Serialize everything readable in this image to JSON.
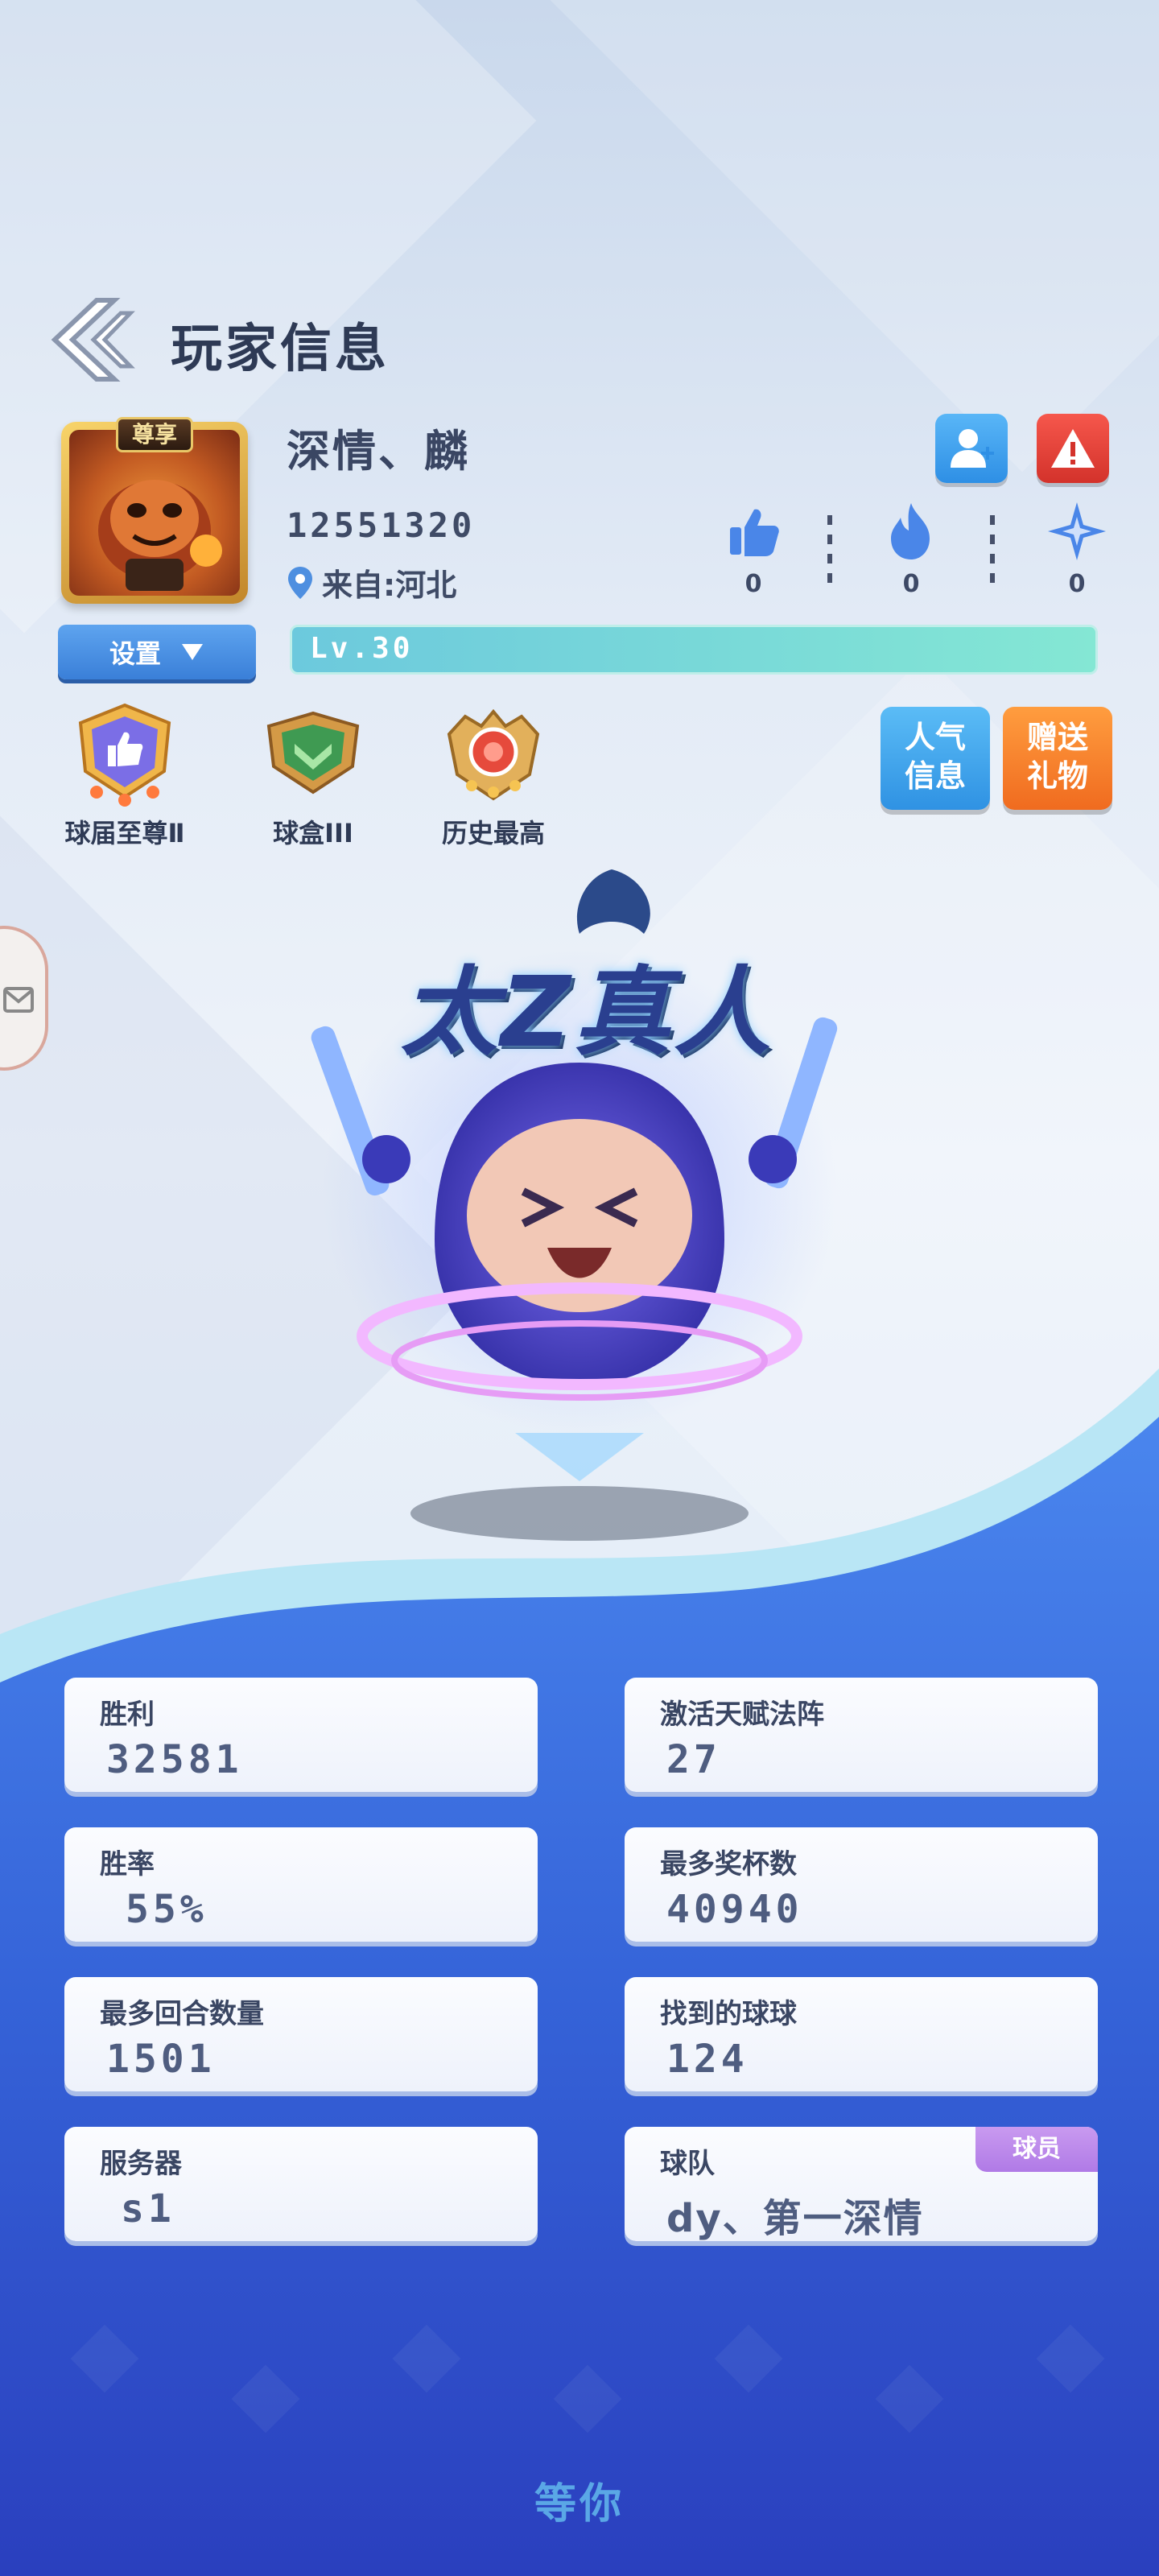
{
  "header": {
    "back_icon": "double-chevron-left-icon",
    "title": "玩家信息"
  },
  "profile": {
    "avatar_badge": "尊享",
    "name": "深情、麟",
    "id": "12551320",
    "location": "来自:河北",
    "settings_label": "设置",
    "level": "Lv.30"
  },
  "actions": {
    "add_friend_icon": "add-user-icon",
    "report_icon": "warning-icon"
  },
  "stats_icons": [
    {
      "name": "like",
      "value": "0"
    },
    {
      "name": "fire",
      "value": "0"
    },
    {
      "name": "star",
      "value": "0"
    }
  ],
  "badges": [
    {
      "label": "球届至尊Ⅱ"
    },
    {
      "label": "球盒III"
    },
    {
      "label": "历史最高"
    }
  ],
  "side_buttons": {
    "popularity_line1": "人气",
    "popularity_line2": "信息",
    "gift_line1": "赠送",
    "gift_line2": "礼物"
  },
  "hero": {
    "title": "太Z真人"
  },
  "stats": {
    "wins_label": "胜利",
    "wins_value": "32581",
    "talent_label": "激活天赋法阵",
    "talent_value": "27",
    "winrate_label": "胜率",
    "winrate_value": "55%",
    "trophies_label": "最多奖杯数",
    "trophies_value": "40940",
    "rounds_label": "最多回合数量",
    "rounds_value": "1501",
    "balls_label": "找到的球球",
    "balls_value": "124",
    "server_label": "服务器",
    "server_value": "s1",
    "team_label": "球队",
    "team_value": "dy、第一深情",
    "team_role": "球员"
  },
  "footer": {
    "text": "等你"
  },
  "colors": {
    "primary_blue": "#3a6fe0",
    "teal": "#6cc9dd",
    "orange": "#f06b1f",
    "red": "#d3322b",
    "purple": "#b07ae6"
  }
}
